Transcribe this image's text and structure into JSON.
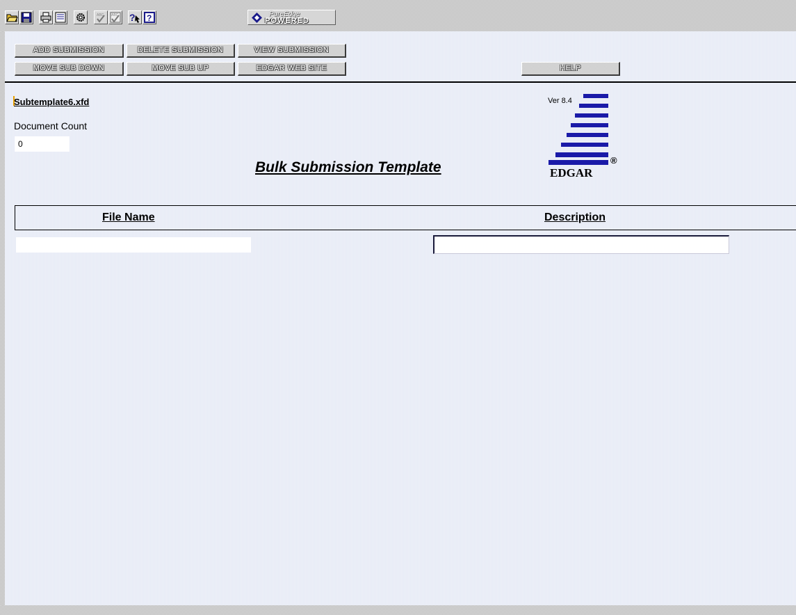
{
  "toolbar": {
    "icons": [
      "open-folder",
      "save",
      "print",
      "print-preview",
      "settings",
      "spell-check",
      "spell-check-all",
      "whats-this-help",
      "help"
    ],
    "brand_top": "PureEdge",
    "brand_bottom": "POWERED"
  },
  "actions": {
    "add_submission": "ADD SUBMISSION",
    "delete_submission": "DELETE SUBMISSION",
    "view_submission": "VIEW SUBMISSION",
    "move_sub_down": "MOVE SUB DOWN",
    "move_sub_up": "MOVE SUB UP",
    "edgar_web_site": "EDGAR WEB SITE",
    "help": "HELP"
  },
  "form": {
    "filename": "Subtemplate6.xfd",
    "document_count_label": "Document Count",
    "document_count_value": "0",
    "title": "Bulk Submission Template",
    "version": "Ver 8.4",
    "logo_word": "EDGAR",
    "logo_reg": "®"
  },
  "table": {
    "columns": [
      "File Name",
      "Description"
    ],
    "rows": [
      {
        "file_name": "",
        "description": ""
      }
    ]
  },
  "colors": {
    "panel_bg": "#e7ebf6",
    "logo_blue": "#1a1aa8"
  }
}
